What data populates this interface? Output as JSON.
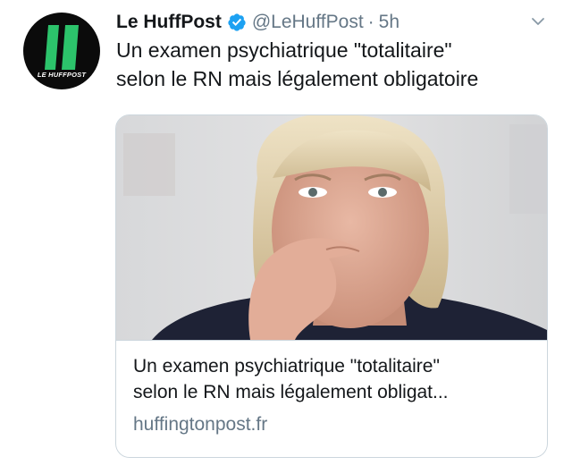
{
  "tweet": {
    "author": {
      "display_name": "Le HuffPost",
      "handle": "@LeHuffPost",
      "separator": "·",
      "timestamp": "5h",
      "verified": true,
      "avatar_logo_text": "LE HUFFPOST",
      "verified_icon": "verified-badge-icon",
      "menu_icon": "chevron-down-icon"
    },
    "text_lines": [
      "Un examen psychiatrique \"totalitaire\"",
      "selon le RN mais légalement obligatoire"
    ],
    "card": {
      "image_label": "link-preview-photo",
      "title_lines": [
        "Un examen psychiatrique \"totalitaire\"",
        "selon le RN mais légalement obligat..."
      ],
      "domain": "huffingtonpost.fr"
    }
  },
  "colors": {
    "text_primary": "#14171a",
    "text_secondary": "#657786",
    "verified_blue": "#1da1f2",
    "huffpost_green": "#2cc36b",
    "card_border": "#ccd6dd"
  }
}
